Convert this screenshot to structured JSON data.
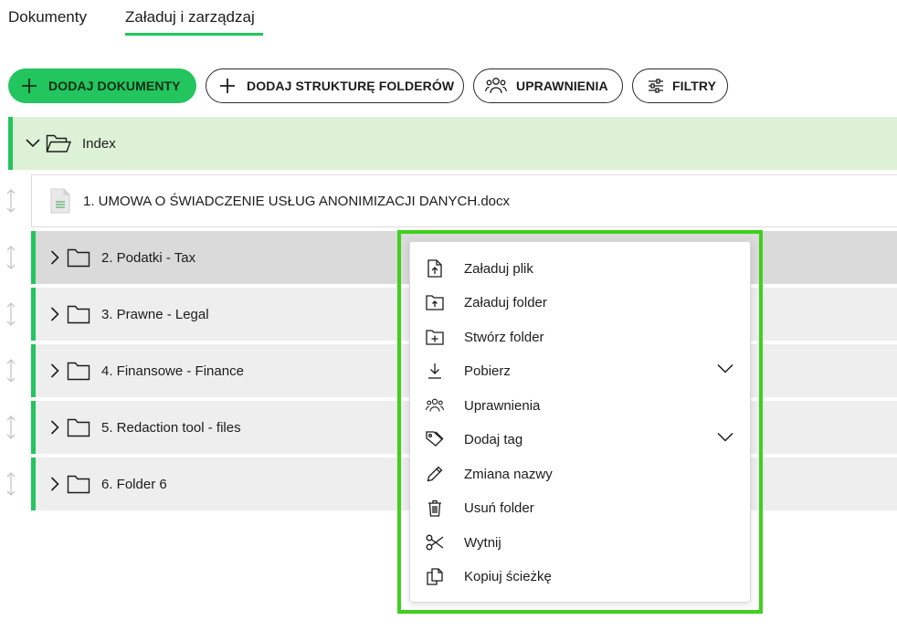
{
  "tabs": [
    {
      "label": "Dokumenty",
      "active": false
    },
    {
      "label": "Załaduj i zarządzaj",
      "active": true
    }
  ],
  "toolbar": {
    "add_documents": "DODAJ DOKUMENTY",
    "add_structure": "DODAJ STRUKTURĘ FOLDERÓW",
    "permissions": "UPRAWNIENIA",
    "filters": "FILTRY"
  },
  "tree": {
    "root": {
      "label": "Index",
      "icon": "folder-open-icon",
      "expanded": true
    },
    "file": {
      "label": "1. UMOWA O ŚWIADCZENIE USŁUG ANONIMIZACJI DANYCH.docx",
      "icon": "document-icon"
    },
    "folders": [
      {
        "label": "2. Podatki - Tax"
      },
      {
        "label": "3. Prawne - Legal"
      },
      {
        "label": "4. Finansowe - Finance"
      },
      {
        "label": "5. Redaction tool - files"
      },
      {
        "label": "6. Folder 6"
      }
    ]
  },
  "context_menu": {
    "items": [
      {
        "label": "Załaduj plik",
        "icon": "file-upload-icon"
      },
      {
        "label": "Załaduj folder",
        "icon": "folder-upload-icon"
      },
      {
        "label": "Stwórz folder",
        "icon": "folder-plus-icon"
      },
      {
        "label": "Pobierz",
        "icon": "download-icon",
        "has_submenu": true
      },
      {
        "label": "Uprawnienia",
        "icon": "users-icon"
      },
      {
        "label": "Dodaj tag",
        "icon": "tag-icon",
        "has_submenu": true
      },
      {
        "label": "Zmiana nazwy",
        "icon": "pencil-icon"
      },
      {
        "label": "Usuń folder",
        "icon": "trash-icon"
      },
      {
        "label": "Wytnij",
        "icon": "scissors-icon"
      },
      {
        "label": "Kopiuj ścieżkę",
        "icon": "copy-icon"
      }
    ]
  },
  "colors": {
    "accent": "#22c55e",
    "root_row_bg": "#dcf1d6",
    "folder_row_bg": "#eeeeee",
    "hover_row_bg": "#dadada",
    "highlight_border": "#3ed01c"
  }
}
